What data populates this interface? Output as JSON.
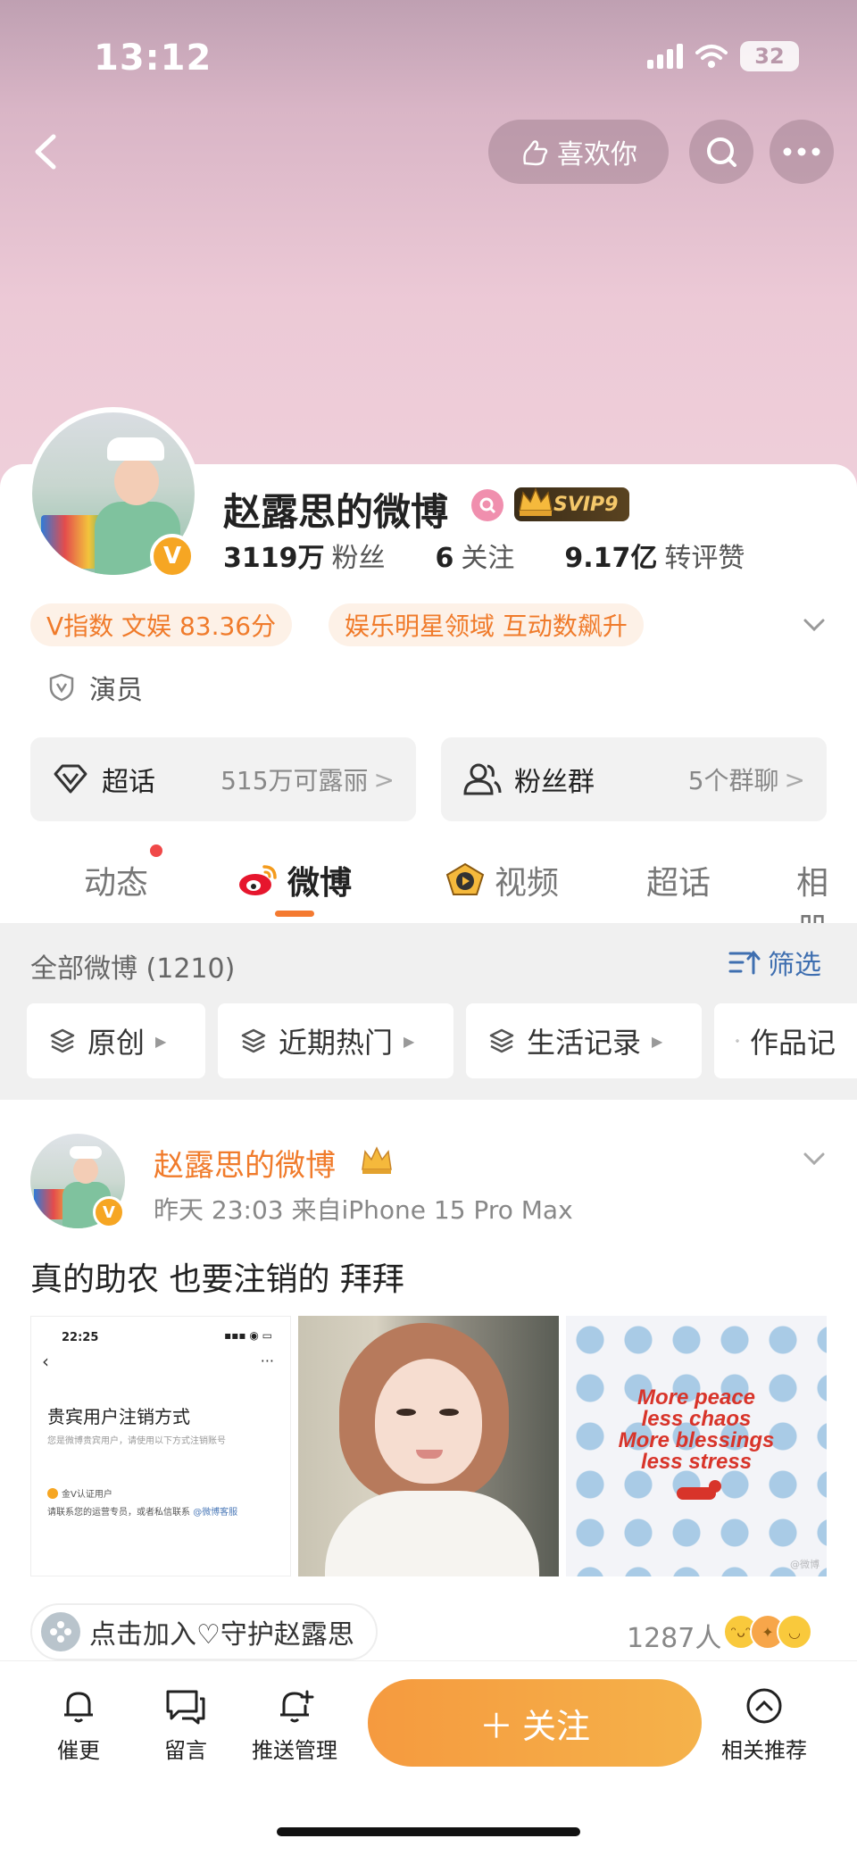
{
  "status_bar": {
    "time": "13:12",
    "battery": "32"
  },
  "header": {
    "like_label": "喜欢你"
  },
  "profile": {
    "name": "赵露思的微博",
    "vip_label": "SVIP9",
    "stats": [
      {
        "number": "3119万",
        "label": "粉丝"
      },
      {
        "number": "6",
        "label": "关注"
      },
      {
        "number": "9.17亿",
        "label": "转评赞"
      }
    ],
    "tags": [
      "V指数 文娱 83.36分",
      "娱乐明星领域 互动数飙升"
    ],
    "occupation": "演员",
    "entries": [
      {
        "title": "超话",
        "sub": "515万可露丽"
      },
      {
        "title": "粉丝群",
        "sub": "5个群聊"
      }
    ]
  },
  "tabs": [
    {
      "label": "动态"
    },
    {
      "label": "微博"
    },
    {
      "label": "视频"
    },
    {
      "label": "超话"
    },
    {
      "label": "相册"
    }
  ],
  "filter": {
    "title": "全部微博 (1210)",
    "filter_label": "筛选",
    "chips": [
      "原创",
      "近期热门",
      "生活记录",
      "作品记"
    ]
  },
  "post": {
    "author": "赵露思的微博",
    "meta": "昨天 23:03  来自iPhone 15 Pro Max",
    "text": "真的助农 也要注销的 拜拜",
    "image1": {
      "time": "22:25",
      "heading": "贵宾用户注销方式",
      "sub": "您是微博贵宾用户，请使用以下方式注销账号",
      "vip_line": "金V认证用户",
      "contact": "请联系您的运营专员，或者私信联系",
      "contact_link": "@微博客服"
    },
    "image3": {
      "lines": [
        "More peace",
        "less chaos",
        "More blessings",
        "less stress"
      ],
      "watermark": "@微博"
    },
    "join_label": "点击加入♡守护赵露思",
    "people": "1287人"
  },
  "bottom_bar": {
    "items": [
      "催更",
      "留言",
      "推送管理"
    ],
    "follow_label": "关注",
    "recommend_label": "相关推荐"
  }
}
